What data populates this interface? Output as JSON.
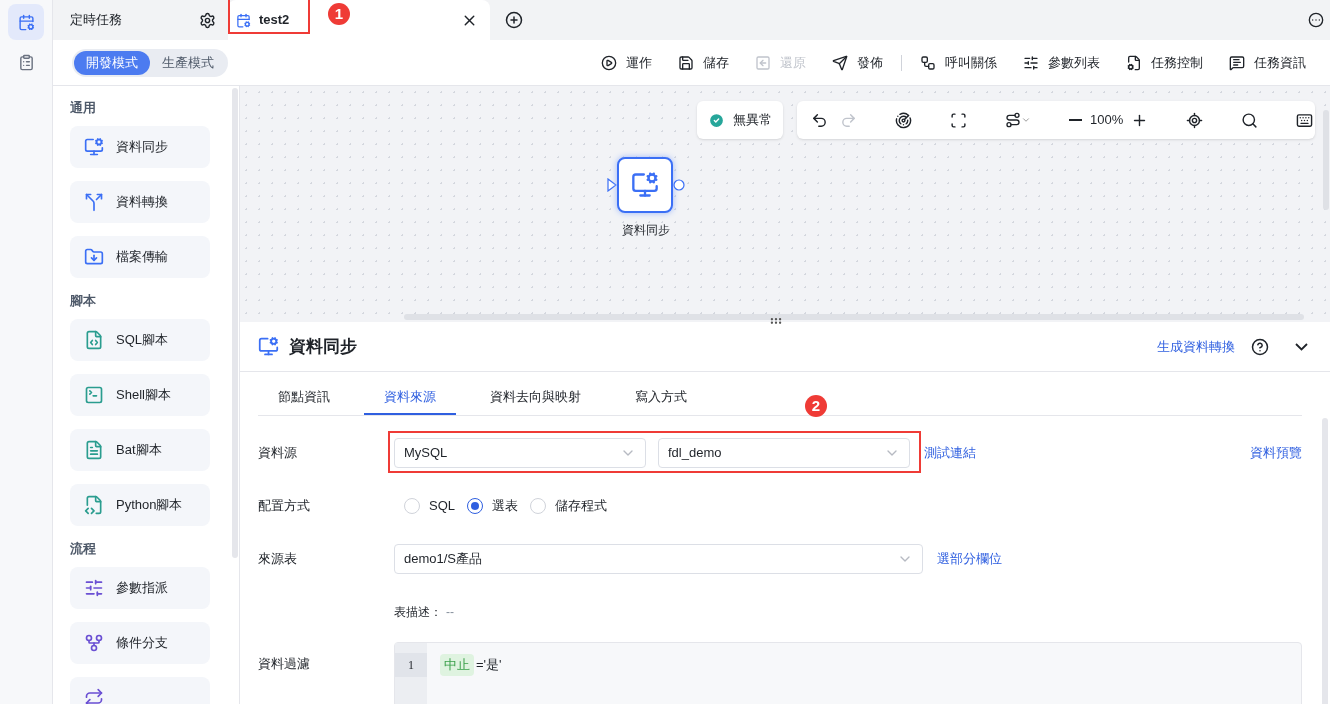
{
  "rail": {
    "items": [
      {
        "kind": "tasks",
        "selected": true
      },
      {
        "kind": "clipboard",
        "selected": false
      }
    ]
  },
  "tabs": [
    {
      "label": "定時任務",
      "kind": "pinned",
      "selected": false
    },
    {
      "label": "test2",
      "kind": "task",
      "selected": true,
      "annotation": "1"
    }
  ],
  "modes": [
    {
      "label": "開發模式",
      "selected": true
    },
    {
      "label": "生產模式",
      "selected": false
    }
  ],
  "toolbar": [
    {
      "label": "運作",
      "kind": "run",
      "disabled": false
    },
    {
      "label": "儲存",
      "kind": "save",
      "disabled": false
    },
    {
      "label": "還原",
      "kind": "restore",
      "disabled": true
    },
    {
      "label": "發佈",
      "kind": "publish",
      "disabled": false
    },
    {
      "label": "呼叫關係",
      "kind": "calls",
      "disabled": false
    },
    {
      "label": "參數列表",
      "kind": "params",
      "disabled": false
    },
    {
      "label": "任務控制",
      "kind": "control",
      "disabled": false
    },
    {
      "label": "任務資訊",
      "kind": "info",
      "disabled": false
    }
  ],
  "palette": [
    {
      "title": "通用",
      "items": [
        {
          "label": "資料同步",
          "kind": "sync"
        },
        {
          "label": "資料轉換",
          "kind": "transform"
        },
        {
          "label": "檔案傳輸",
          "kind": "file"
        }
      ]
    },
    {
      "title": "腳本",
      "items": [
        {
          "label": "SQL腳本",
          "kind": "sql"
        },
        {
          "label": "Shell腳本",
          "kind": "shell"
        },
        {
          "label": "Bat腳本",
          "kind": "bat"
        },
        {
          "label": "Python腳本",
          "kind": "python"
        }
      ]
    },
    {
      "title": "流程",
      "items": [
        {
          "label": "參數指派",
          "kind": "assign"
        },
        {
          "label": "條件分支",
          "kind": "branch"
        },
        {
          "kind": "loop"
        }
      ]
    }
  ],
  "canvas": {
    "status": {
      "label": "無異常",
      "ok": true
    },
    "zoom": "100%",
    "node": {
      "label": "資料同步",
      "selected": true
    }
  },
  "panel": {
    "title": "資料同步",
    "action": "生成資料轉換",
    "tabs": [
      {
        "label": "節點資訊",
        "selected": false
      },
      {
        "label": "資料來源",
        "selected": true
      },
      {
        "label": "資料去向與映射",
        "selected": false
      },
      {
        "label": "寫入方式",
        "selected": false
      }
    ],
    "source": {
      "label": "資料源",
      "selects": [
        "MySQL",
        "fdl_demo"
      ],
      "link": "測試連結",
      "preview": "資料預覽",
      "annotation": "2"
    },
    "mode": {
      "label": "配置方式",
      "options": [
        {
          "label": "SQL",
          "selected": false
        },
        {
          "label": "選表",
          "selected": true
        },
        {
          "label": "儲存程式",
          "selected": false
        }
      ]
    },
    "table": {
      "label": "來源表",
      "value": "demo1/S產品",
      "link": "選部分欄位"
    },
    "description": {
      "label": "表描述：",
      "value": "--"
    },
    "filter": {
      "label": "資料過濾",
      "lines": [
        {
          "number": "1",
          "tokens": [
            {
              "text": "中止",
              "kind": "field"
            },
            {
              "text": "='是'",
              "kind": "plain"
            }
          ]
        }
      ]
    }
  }
}
